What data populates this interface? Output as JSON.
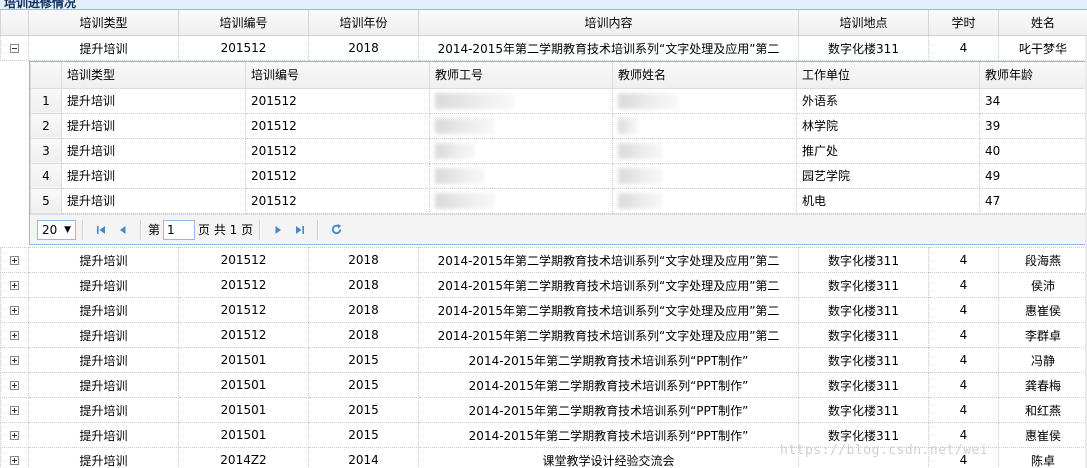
{
  "panel_title": "培训进修情况",
  "outer_columns": [
    "培训类型",
    "培训编号",
    "培训年份",
    "培训内容",
    "培训地点",
    "学时",
    "姓名"
  ],
  "expanded_row": {
    "type": "提升培训",
    "code": "201512",
    "year": "2018",
    "content": "2014-2015年第二学期教育技术培训系列“文字处理及应用”第二",
    "place": "数字化楼311",
    "hours": "4",
    "name": "叱干梦华"
  },
  "detail": {
    "columns": [
      "培训类型",
      "培训编号",
      "教师工号",
      "教师姓名",
      "工作单位",
      "教师年龄"
    ],
    "rows": [
      {
        "num": "1",
        "type": "提升培训",
        "code": "201512",
        "unit": "外语系",
        "age": "34"
      },
      {
        "num": "2",
        "type": "提升培训",
        "code": "201512",
        "unit": "林学院",
        "age": "39"
      },
      {
        "num": "3",
        "type": "提升培训",
        "code": "201512",
        "unit": "推广处",
        "age": "40"
      },
      {
        "num": "4",
        "type": "提升培训",
        "code": "201512",
        "unit": "园艺学院",
        "age": "49"
      },
      {
        "num": "5",
        "type": "提升培训",
        "code": "201512",
        "unit": "机电",
        "age": "47"
      }
    ],
    "pager": {
      "page_size": "20",
      "page_prefix": "第",
      "page_value": "1",
      "page_suffix": "页 共 1 页"
    }
  },
  "rows": [
    {
      "type": "提升培训",
      "code": "201512",
      "year": "2018",
      "content": "2014-2015年第二学期教育技术培训系列“文字处理及应用”第二",
      "place": "数字化楼311",
      "hours": "4",
      "name": "段海燕"
    },
    {
      "type": "提升培训",
      "code": "201512",
      "year": "2018",
      "content": "2014-2015年第二学期教育技术培训系列“文字处理及应用”第二",
      "place": "数字化楼311",
      "hours": "4",
      "name": "侯沛"
    },
    {
      "type": "提升培训",
      "code": "201512",
      "year": "2018",
      "content": "2014-2015年第二学期教育技术培训系列“文字处理及应用”第二",
      "place": "数字化楼311",
      "hours": "4",
      "name": "惠崔侯"
    },
    {
      "type": "提升培训",
      "code": "201512",
      "year": "2018",
      "content": "2014-2015年第二学期教育技术培训系列“文字处理及应用”第二",
      "place": "数字化楼311",
      "hours": "4",
      "name": "李群卓"
    },
    {
      "type": "提升培训",
      "code": "201501",
      "year": "2015",
      "content": "2014-2015年第二学期教育技术培训系列“PPT制作”",
      "place": "数字化楼311",
      "hours": "4",
      "name": "冯静"
    },
    {
      "type": "提升培训",
      "code": "201501",
      "year": "2015",
      "content": "2014-2015年第二学期教育技术培训系列“PPT制作”",
      "place": "数字化楼311",
      "hours": "4",
      "name": "龚春梅"
    },
    {
      "type": "提升培训",
      "code": "201501",
      "year": "2015",
      "content": "2014-2015年第二学期教育技术培训系列“PPT制作”",
      "place": "数字化楼311",
      "hours": "4",
      "name": "和红燕"
    },
    {
      "type": "提升培训",
      "code": "201501",
      "year": "2015",
      "content": "2014-2015年第二学期教育技术培训系列“PPT制作”",
      "place": "数字化楼311",
      "hours": "4",
      "name": "惠崔侯"
    },
    {
      "type": "提升培训",
      "code": "2014Z2",
      "year": "2014",
      "content": "课堂教学设计经验交流会",
      "place": "",
      "hours": "4",
      "name": "陈卓"
    }
  ],
  "watermark": "https://blog.csdn.net/wei",
  "colors": {
    "accent": "#95b8e7",
    "header_bg": "#efefef",
    "pager_icon": "#4a87c8"
  }
}
